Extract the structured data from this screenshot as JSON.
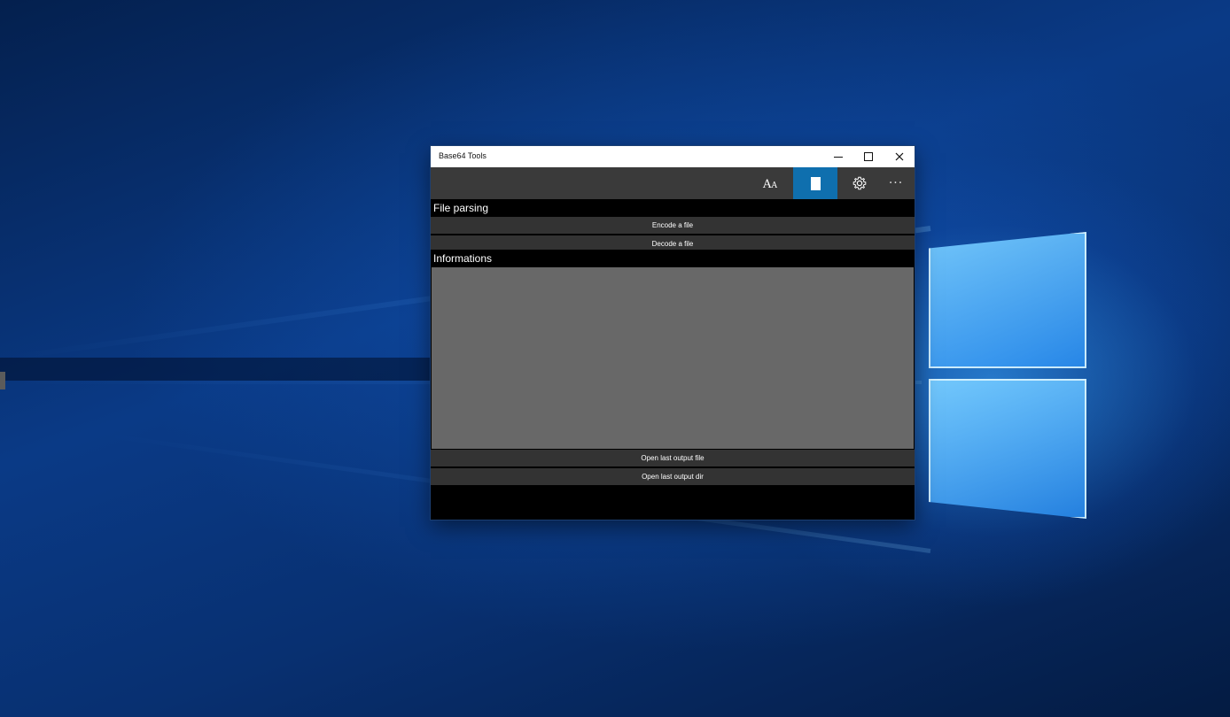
{
  "window": {
    "title": "Base64 Tools",
    "minimize_label": "",
    "maximize_label": "",
    "close_label": ""
  },
  "toolbar": {
    "font_icon": "font-size-icon",
    "page_icon": "page-icon",
    "settings_icon": "gear-icon",
    "more_label": "···",
    "accent_color": "#0f6fae"
  },
  "file_parsing": {
    "header": "File parsing",
    "encode_label": "Encode a file",
    "decode_label": "Decode a file"
  },
  "informations": {
    "header": "Informations",
    "content": ""
  },
  "output": {
    "open_file_label": "Open last output file",
    "open_dir_label": "Open last output dir"
  }
}
